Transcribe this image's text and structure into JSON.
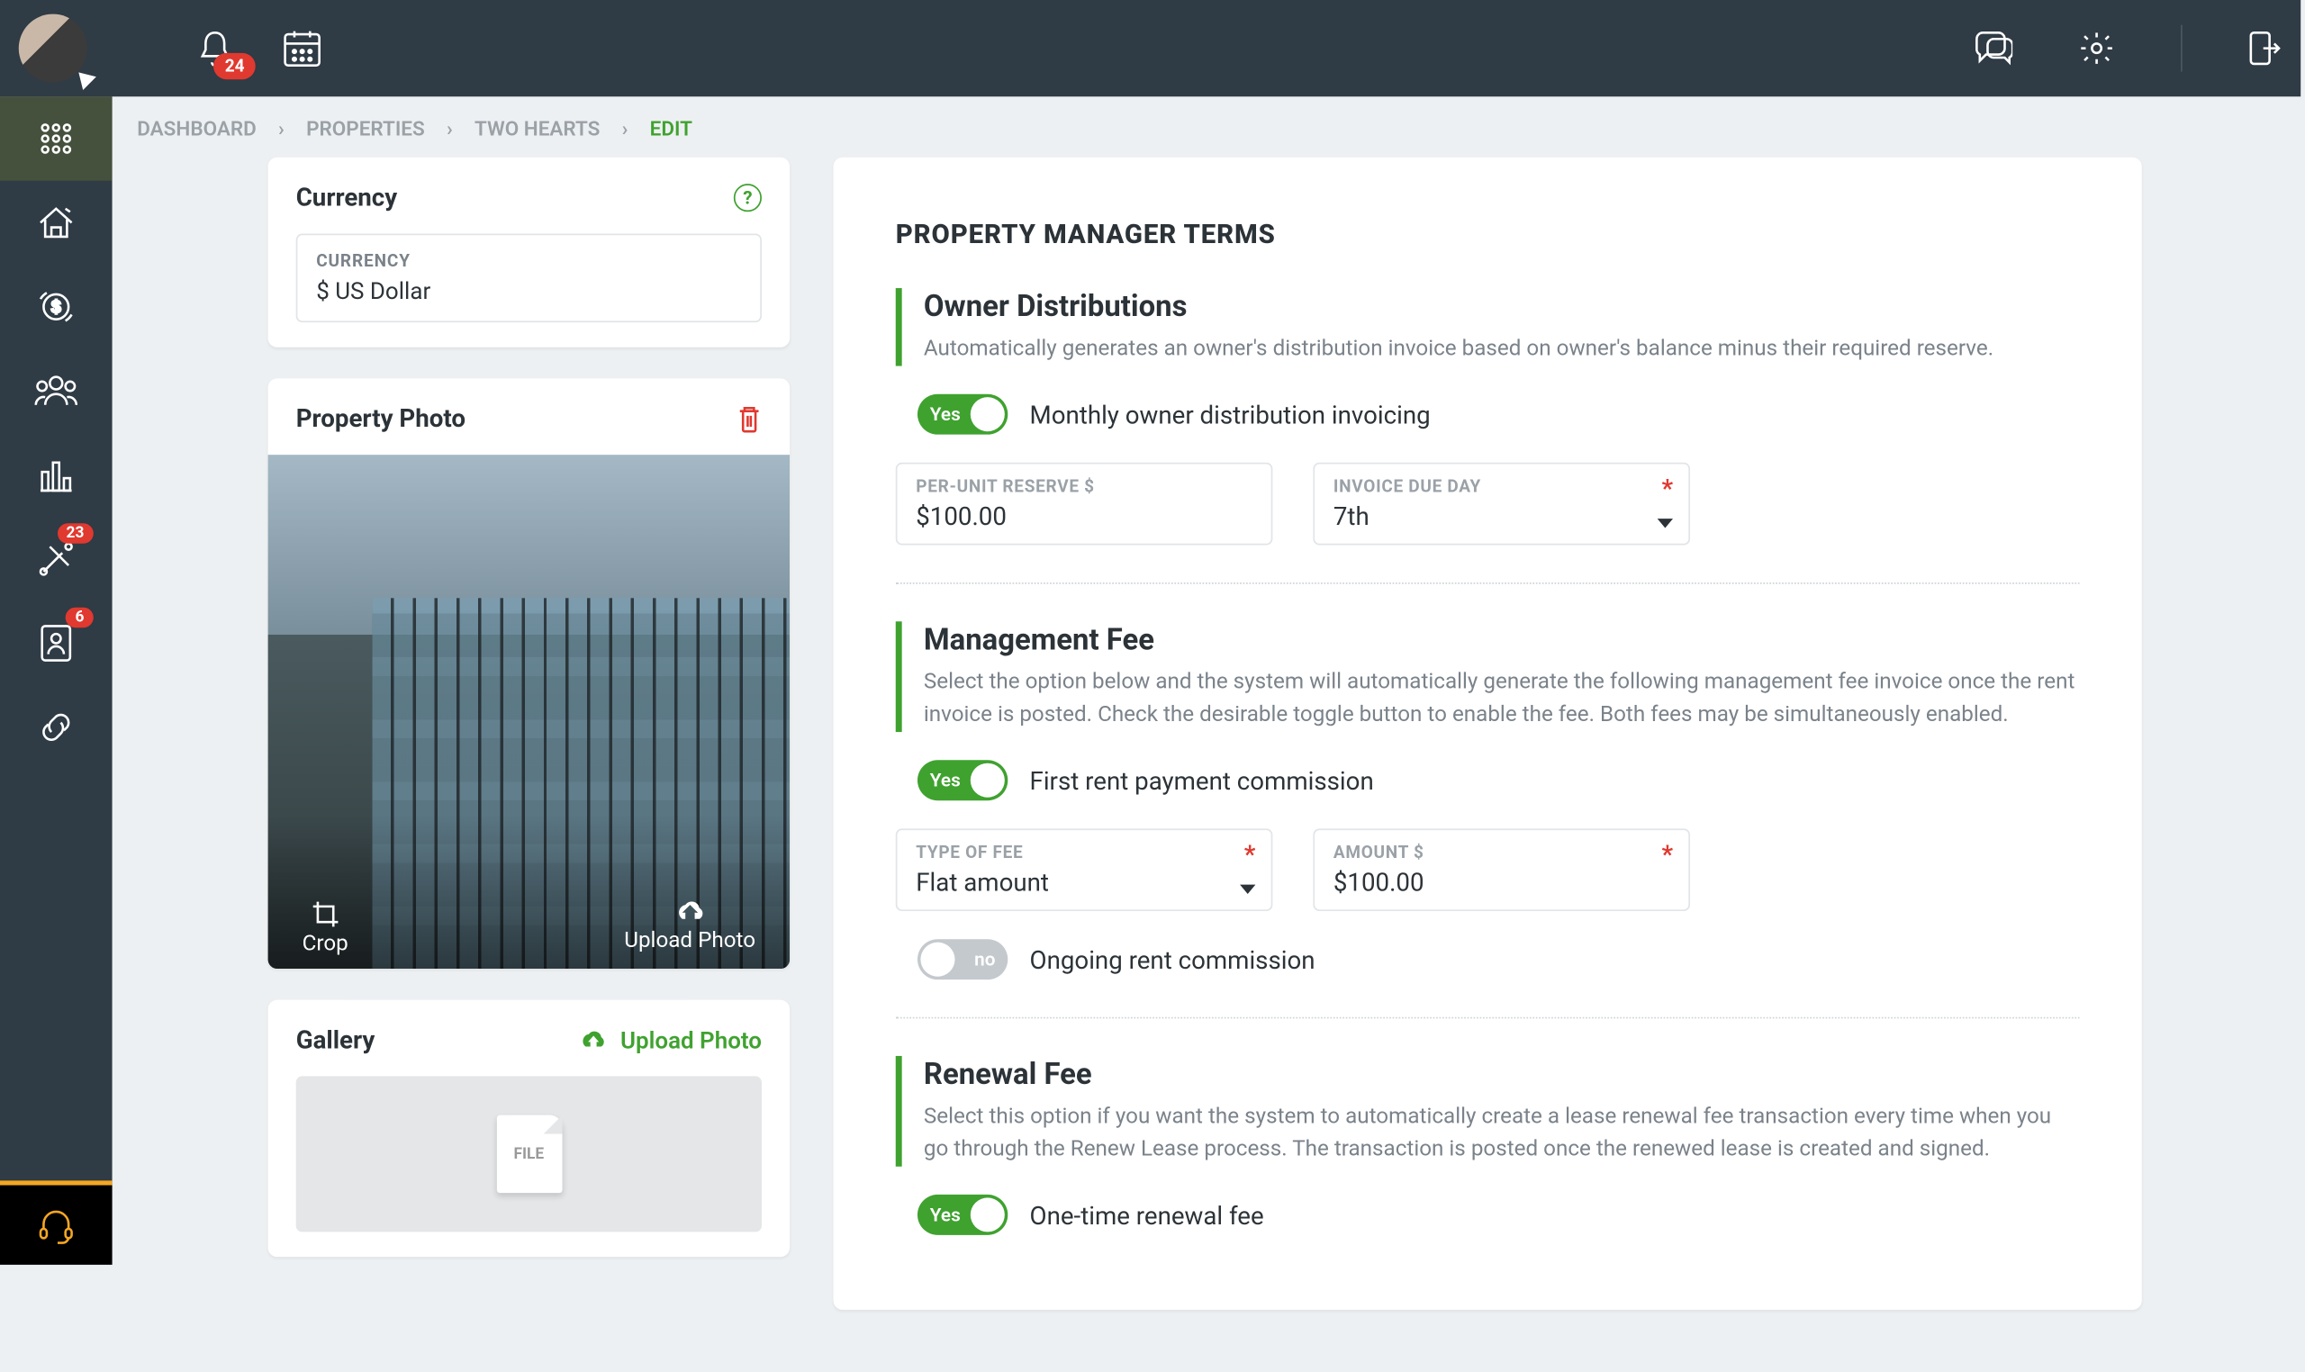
{
  "header": {
    "notif_count": "24"
  },
  "sidebar": {
    "badges": {
      "tools": "23",
      "contacts": "6"
    }
  },
  "breadcrumb": {
    "items": [
      "DASHBOARD",
      "PROPERTIES",
      "TWO HEARTS"
    ],
    "current": "EDIT"
  },
  "currency": {
    "title": "Currency",
    "label": "CURRENCY",
    "value": "$ US Dollar"
  },
  "photo": {
    "title": "Property Photo",
    "crop": "Crop",
    "upload": "Upload Photo"
  },
  "gallery": {
    "title": "Gallery",
    "upload": "Upload Photo",
    "file_tag": "FILE"
  },
  "panel": {
    "title": "PROPERTY MANAGER TERMS",
    "owner": {
      "title": "Owner Distributions",
      "desc": "Automatically generates an owner's distribution invoice based on owner's balance minus their required reserve.",
      "toggle_label": "Monthly owner distribution invoicing",
      "toggle_on_text": "Yes",
      "reserve_label": "PER-UNIT RESERVE $",
      "reserve_value": "$100.00",
      "due_label": "INVOICE DUE DAY",
      "due_value": "7th"
    },
    "mgmt": {
      "title": "Management Fee",
      "desc": "Select the option below and the system will automatically generate the following management fee invoice once the rent invoice is posted. Check the desirable toggle button to enable the fee. Both fees may be simultaneously enabled.",
      "first_toggle": "First rent payment commission",
      "first_on_text": "Yes",
      "type_label": "TYPE OF FEE",
      "type_value": "Flat amount",
      "amount_label": "AMOUNT $",
      "amount_value": "$100.00",
      "ongoing_toggle": "Ongoing rent commission",
      "ongoing_off_text": "no"
    },
    "renewal": {
      "title": "Renewal Fee",
      "desc": "Select this option if you want the system to automatically create a lease renewal fee transaction every time when you go through the Renew Lease process. The transaction is posted once the renewed lease is created and signed.",
      "toggle": "One-time renewal fee",
      "on_text": "Yes"
    }
  }
}
